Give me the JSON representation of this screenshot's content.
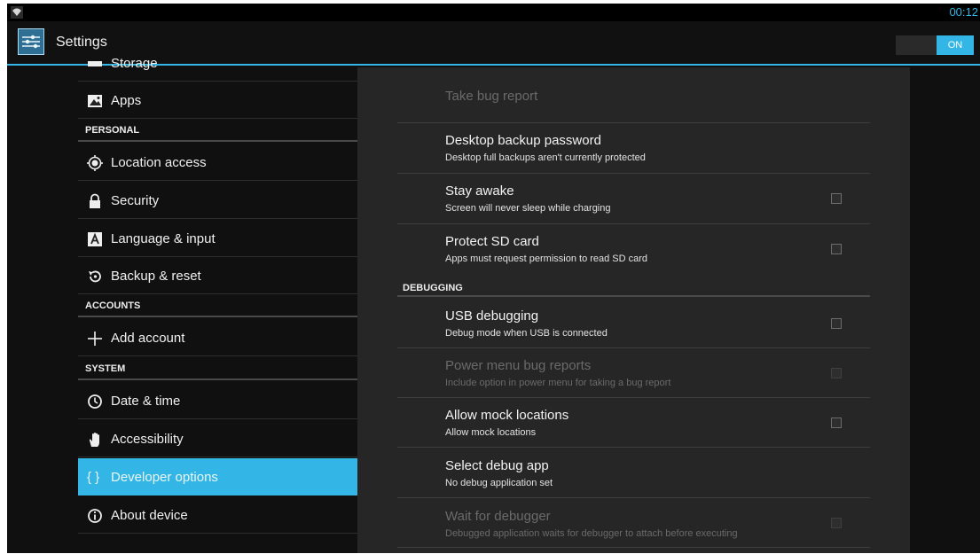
{
  "statusbar": {
    "time": "00:12",
    "icon": "wifi-icon"
  },
  "actionbar": {
    "title": "Settings",
    "icon": "settings-sliders-icon",
    "toggle_label": "ON"
  },
  "nav": {
    "partial_item": "Storage",
    "apps": "Apps",
    "personal": "PERSONAL",
    "location": "Location access",
    "security": "Security",
    "language": "Language & input",
    "backup": "Backup & reset",
    "accounts": "ACCOUNTS",
    "add_account": "Add account",
    "system": "SYSTEM",
    "date_time": "Date & time",
    "accessibility": "Accessibility",
    "developer": "Developer options",
    "developer_glyph": "{ }",
    "about": "About device"
  },
  "prefs": {
    "bug_report": {
      "title": "Take bug report"
    },
    "backup_password": {
      "title": "Desktop backup password",
      "summary": "Desktop full backups aren't currently protected"
    },
    "stay_awake": {
      "title": "Stay awake",
      "summary": "Screen will never sleep while charging",
      "checked": false
    },
    "protect_sd": {
      "title": "Protect SD card",
      "summary": "Apps must request permission to read SD card",
      "checked": false
    },
    "debugging_header": "DEBUGGING",
    "usb_debugging": {
      "title": "USB debugging",
      "summary": "Debug mode when USB is connected",
      "checked": false
    },
    "power_menu": {
      "title": "Power menu bug reports",
      "summary": "Include option in power menu for taking a bug report",
      "checked": false
    },
    "mock_locations": {
      "title": "Allow mock locations",
      "summary": "Allow mock locations",
      "checked": false
    },
    "debug_app": {
      "title": "Select debug app",
      "summary": "No debug application set"
    },
    "wait_debugger": {
      "title": "Wait for debugger",
      "summary": "Debugged application waits for debugger to attach before executing",
      "checked": false
    }
  },
  "colors": {
    "accent": "#33b5e5",
    "background": "#101010",
    "pane": "#262626"
  }
}
